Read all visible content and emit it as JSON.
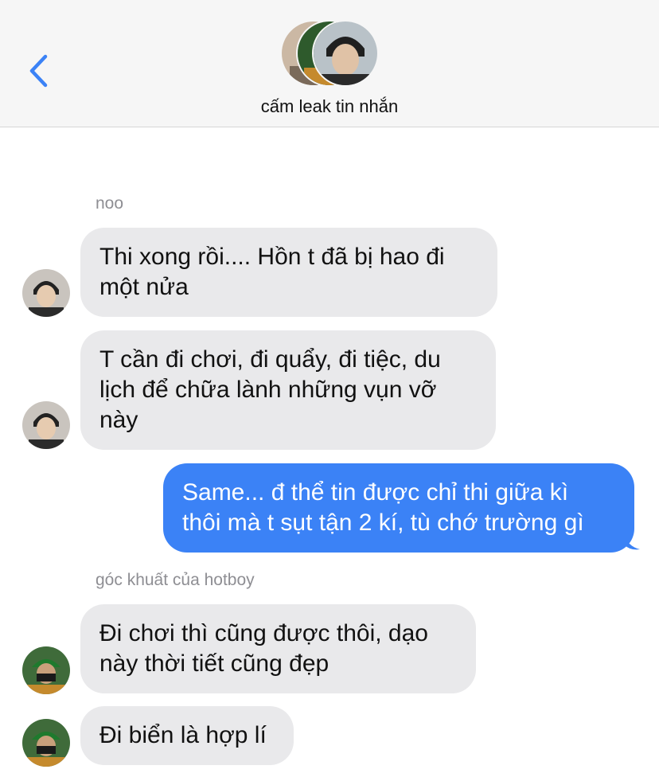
{
  "header": {
    "back_icon": "chevron-left-icon",
    "group_name": "cấm leak tin nhắn",
    "accent": "#3b82f6"
  },
  "messages": [
    {
      "sender": "noo",
      "text_lines": [
        "Thi xong rồi.... Hồn t đã bị hao đi",
        "một nửa"
      ],
      "direction": "incoming"
    },
    {
      "text_lines": [
        "T cần đi chơi, đi quẩy, đi tiệc, du",
        "lịch để chữa lành những vụn vỡ",
        "này"
      ],
      "direction": "incoming"
    },
    {
      "text_lines": [
        "Same... đ thể tin được chỉ thi giữa kì",
        "thôi mà t sụt tận 2 kí, tù chớ trường gì"
      ],
      "direction": "outgoing"
    },
    {
      "sender": "góc khuất của hotboy",
      "text_lines": [
        "Đi chơi thì cũng được thôi, dạo",
        "này thời tiết cũng đẹp"
      ],
      "direction": "incoming"
    },
    {
      "text_lines": [
        "Đi biển là hợp lí"
      ],
      "direction": "incoming"
    }
  ],
  "colors": {
    "incoming_bubble": "#e9e9eb",
    "outgoing_bubble": "#3b82f6",
    "sender_label": "#8e8e93"
  }
}
